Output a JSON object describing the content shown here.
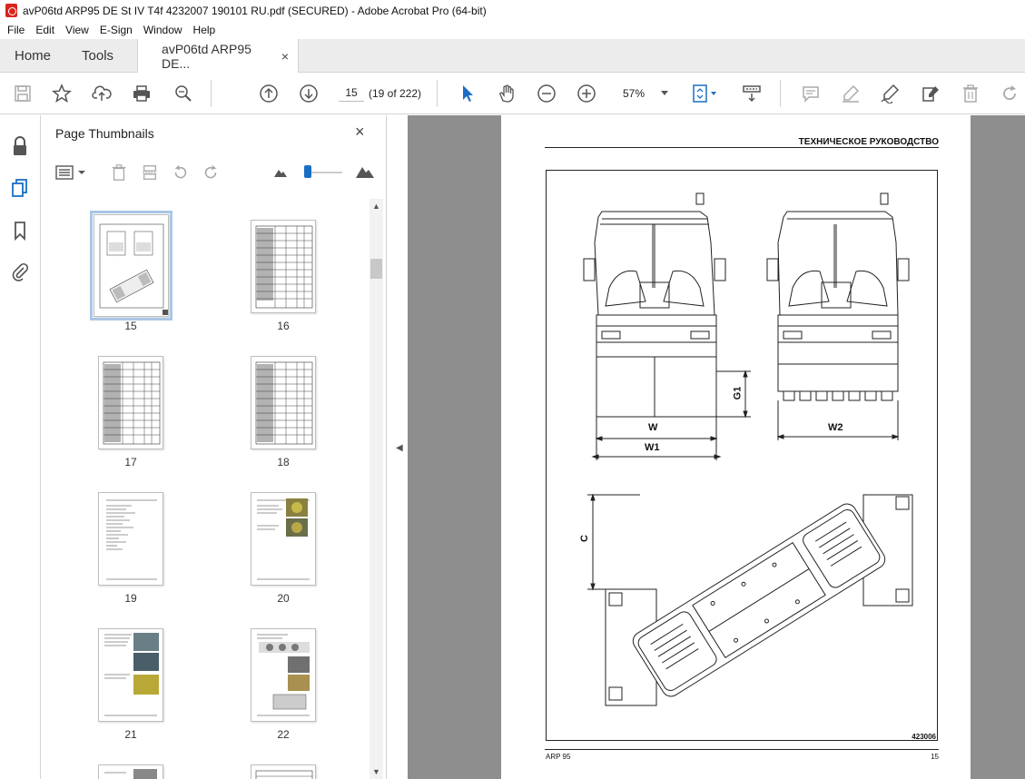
{
  "window": {
    "title": "avP06td ARP95 DE St IV T4f 4232007 190101 RU.pdf (SECURED) - Adobe Acrobat Pro (64-bit)"
  },
  "menu": [
    "File",
    "Edit",
    "View",
    "E-Sign",
    "Window",
    "Help"
  ],
  "tabs": {
    "home": "Home",
    "tools": "Tools",
    "document": "avP06td ARP95 DE...",
    "close": "×"
  },
  "toolbar": {
    "page_value": "15",
    "page_count": "(19 of 222)",
    "zoom": "57%"
  },
  "thumbnails_panel": {
    "title": "Page Thumbnails",
    "close": "×",
    "pages": [
      {
        "label": "15",
        "selected": true,
        "kind": "drawing"
      },
      {
        "label": "16",
        "selected": false,
        "kind": "table"
      },
      {
        "label": "17",
        "selected": false,
        "kind": "table"
      },
      {
        "label": "18",
        "selected": false,
        "kind": "table"
      },
      {
        "label": "19",
        "selected": false,
        "kind": "text"
      },
      {
        "label": "20",
        "selected": false,
        "kind": "photos"
      },
      {
        "label": "21",
        "selected": false,
        "kind": "photos"
      },
      {
        "label": "22",
        "selected": false,
        "kind": "photos"
      }
    ]
  },
  "document_page": {
    "header": "ТЕХНИЧЕСКОЕ РУКОВОДСТВО",
    "figure_id": "423006",
    "footer_model": "ARP 95",
    "footer_page": "15",
    "dimensions": {
      "w": "W",
      "w1": "W1",
      "w2": "W2",
      "g1": "G1",
      "c": "C"
    }
  },
  "colors": {
    "accent": "#1a6fc4",
    "selection": "#aac7e6",
    "viewer_bg": "#8e8e8e"
  }
}
